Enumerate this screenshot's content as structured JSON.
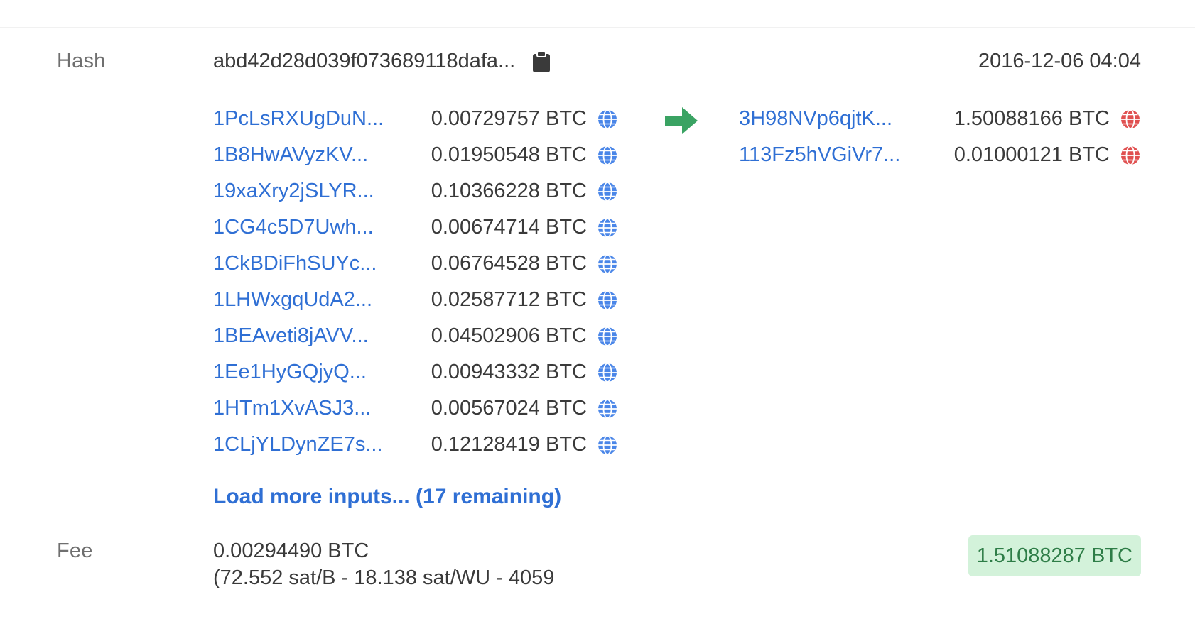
{
  "hash": {
    "label": "Hash",
    "value": "abd42d28d039f073689118dafa...",
    "copy_icon": "clipboard-icon"
  },
  "timestamp": "2016-12-06 04:04",
  "inputs": [
    {
      "address": "1PcLsRXUgDuN...",
      "amount": "0.00729757 BTC"
    },
    {
      "address": "1B8HwAVyzKV...",
      "amount": "0.01950548 BTC"
    },
    {
      "address": "19xaXry2jSLYR...",
      "amount": "0.10366228 BTC"
    },
    {
      "address": "1CG4c5D7Uwh...",
      "amount": "0.00674714 BTC"
    },
    {
      "address": "1CkBDiFhSUYc...",
      "amount": "0.06764528 BTC"
    },
    {
      "address": "1LHWxgqUdA2...",
      "amount": "0.02587712 BTC"
    },
    {
      "address": "1BEAveti8jAVV...",
      "amount": "0.04502906 BTC"
    },
    {
      "address": "1Ee1HyGQjyQ...",
      "amount": "0.00943332 BTC"
    },
    {
      "address": "1HTm1XvASJ3...",
      "amount": "0.00567024 BTC"
    },
    {
      "address": "1CLjYLDynZE7s...",
      "amount": "0.12128419 BTC"
    }
  ],
  "load_more": "Load more inputs... (17 remaining)",
  "outputs": [
    {
      "address": "3H98NVp6qjtK...",
      "amount": "1.50088166 BTC"
    },
    {
      "address": "113Fz5hVGiVr7...",
      "amount": "0.01000121 BTC"
    }
  ],
  "fee": {
    "label": "Fee",
    "amount": "0.00294490 BTC",
    "rate": "(72.552 sat/B - 18.138 sat/WU - 4059"
  },
  "total": "1.51088287 BTC",
  "colors": {
    "address": "#2f6fd4",
    "input_globe": "#4a86e8",
    "output_globe": "#e05050",
    "arrow": "#3aa363",
    "total_bg": "#d3f2da",
    "total_text": "#2e7d47"
  },
  "icons": {
    "input_status": "globe-icon",
    "output_status": "globe-icon",
    "flow": "arrow-right-icon"
  }
}
